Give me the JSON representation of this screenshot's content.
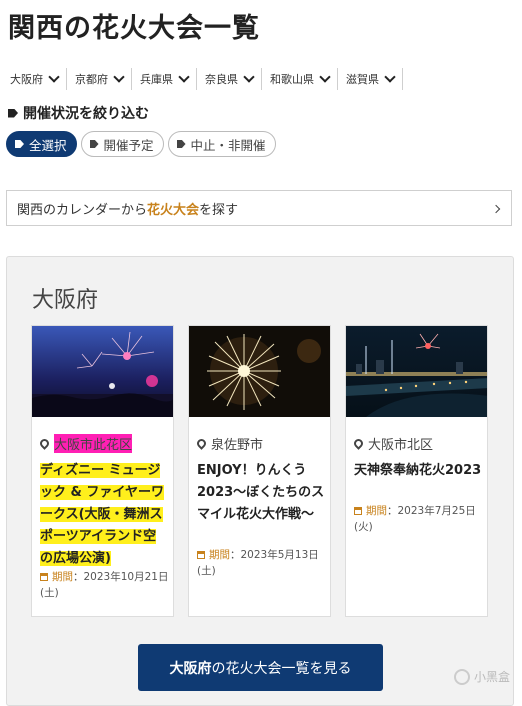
{
  "page": {
    "title": "関西の花火大会一覧"
  },
  "prefectures": [
    {
      "label": "大阪府"
    },
    {
      "label": "京都府"
    },
    {
      "label": "兵庫県"
    },
    {
      "label": "奈良県"
    },
    {
      "label": "和歌山県"
    },
    {
      "label": "滋賀県"
    }
  ],
  "filter": {
    "heading": "開催状況を絞り込む",
    "options": [
      {
        "label": "全選択",
        "active": true
      },
      {
        "label": "開催予定",
        "active": false
      },
      {
        "label": "中止・非開催",
        "active": false
      }
    ]
  },
  "calendar_link": {
    "prefix": "関西のカレンダーから",
    "highlight": "花火大会",
    "suffix": "を探す"
  },
  "region": {
    "title": "大阪府",
    "cards": [
      {
        "location": "大阪市此花区",
        "name": "ディズニー ミュージック & ファイヤーワークス(大阪・舞洲スポーツアイランド空の広場公演)",
        "period_label": "期間",
        "period_value": "：2023年10月21日(土)"
      },
      {
        "location": "泉佐野市",
        "name": "ENJOY！りんくう2023～ぼくたちのスマイル花火大作戦～",
        "period_label": "期間",
        "period_value": "：2023年5月13日(土)"
      },
      {
        "location": "大阪市北区",
        "name": "天神祭奉納花火2023",
        "period_label": "期間",
        "period_value": "：2023年7月25日(火)"
      }
    ],
    "cta": {
      "strong": "大阪府",
      "rest": "の花火大会一覧を見る"
    }
  },
  "watermark": {
    "text": "小黑盒"
  },
  "colors": {
    "navy": "#0f3a73",
    "accent": "#c8821c",
    "highlight_yellow": "#ffef1c",
    "highlight_pink": "#ff1fb4"
  }
}
